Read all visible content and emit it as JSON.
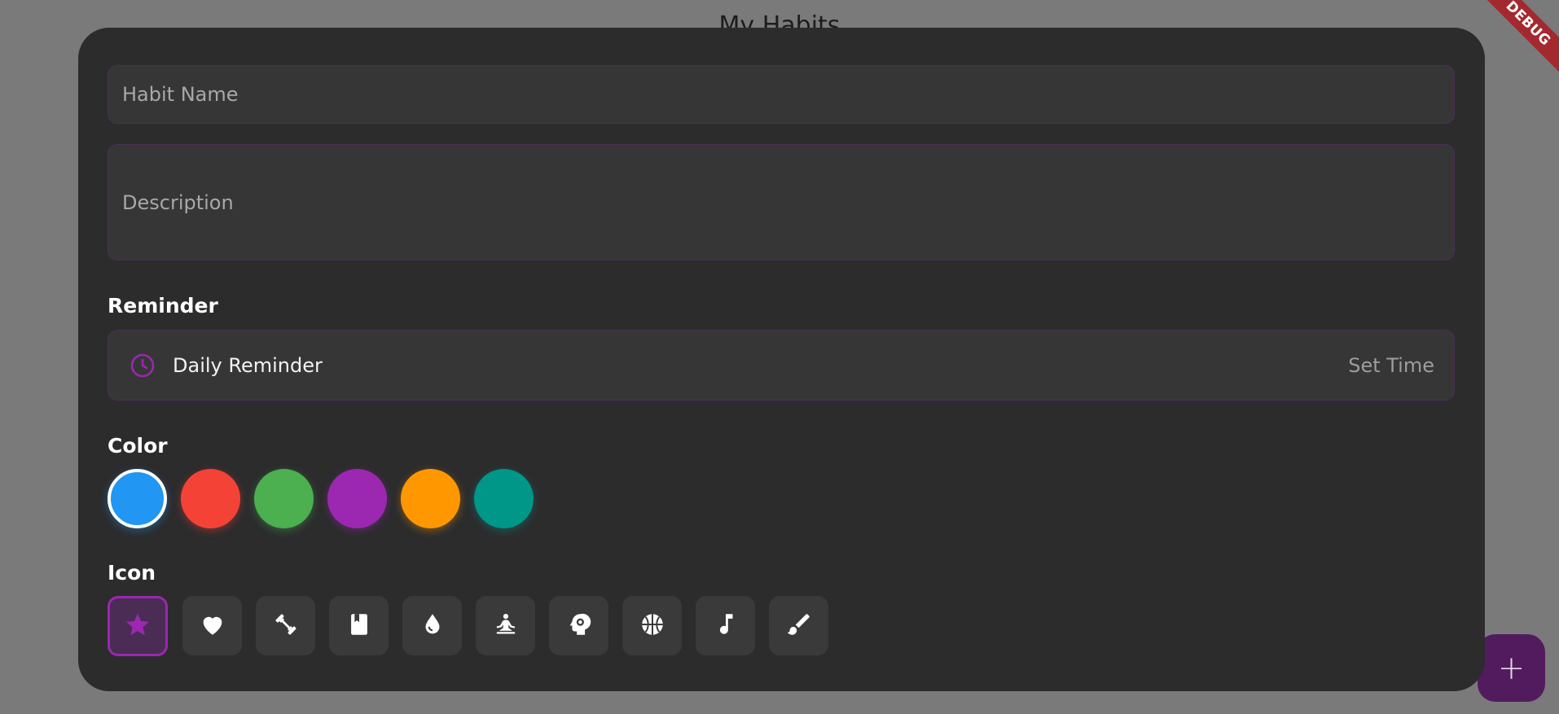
{
  "background": {
    "title": "My Habits"
  },
  "debug_banner": "DEBUG",
  "fab": {
    "icon": "plus-icon",
    "label": "+"
  },
  "form": {
    "name_placeholder": "Habit Name",
    "name_value": "",
    "description_placeholder": "Description",
    "description_value": ""
  },
  "reminder": {
    "section_title": "Reminder",
    "icon": "clock-icon",
    "label": "Daily Reminder",
    "action": "Set Time"
  },
  "color": {
    "section_title": "Color",
    "options": [
      "#2196F3",
      "#F44336",
      "#4CAF50",
      "#9C27B0",
      "#FF9800",
      "#009688"
    ],
    "selected_index": 0
  },
  "icon": {
    "section_title": "Icon",
    "options": [
      "star-icon",
      "heart-icon",
      "dumbbell-icon",
      "book-icon",
      "water-drop-icon",
      "meditation-icon",
      "psychology-icon",
      "basketball-icon",
      "music-note-icon",
      "brush-icon"
    ],
    "selected_index": 0
  },
  "colors": {
    "accent": "#9C27B0",
    "sheet_bg": "#2C2C2D",
    "field_bg": "#363637"
  }
}
